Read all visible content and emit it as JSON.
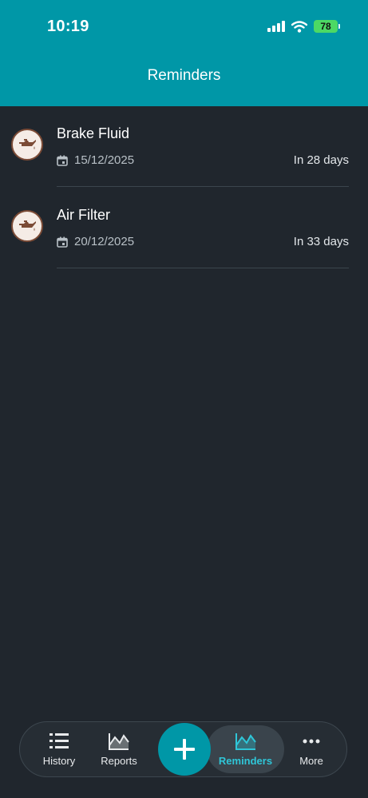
{
  "status_bar": {
    "time": "10:19",
    "battery": "78"
  },
  "header": {
    "title": "Reminders"
  },
  "reminders": [
    {
      "name": "Brake Fluid",
      "date": "15/12/2025",
      "due": "In 28 days"
    },
    {
      "name": "Air Filter",
      "date": "20/12/2025",
      "due": "In 33 days"
    }
  ],
  "nav": {
    "history": "History",
    "reports": "Reports",
    "reminders": "Reminders",
    "more": "More"
  },
  "colors": {
    "accent": "#0097a7",
    "background": "#20262d",
    "icon_brown": "#7b4b36"
  },
  "icons": [
    "signal-icon",
    "wifi-icon",
    "battery-icon",
    "oil-can-icon",
    "calendar-icon",
    "list-icon",
    "chart-icon",
    "plus-icon",
    "more-icon"
  ]
}
